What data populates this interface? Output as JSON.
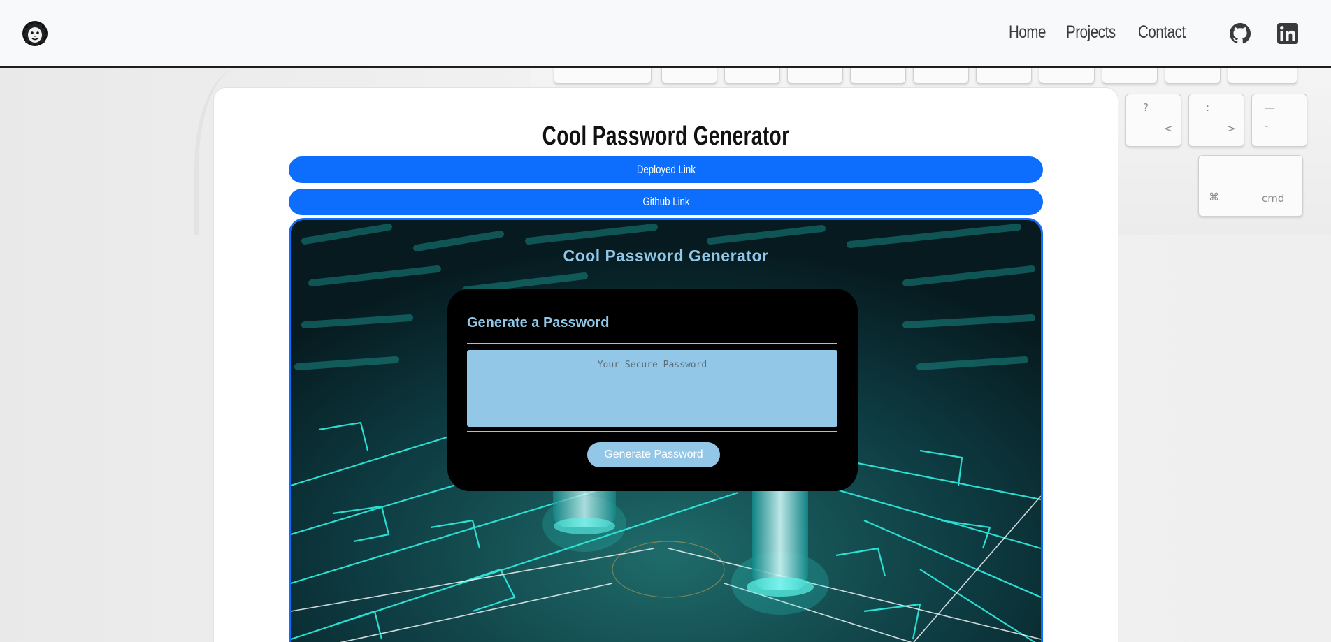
{
  "nav": {
    "links": [
      "Home",
      "Projects",
      "Contact"
    ],
    "social_icons": [
      "github-icon",
      "linkedin-icon"
    ],
    "logo_icon": "lion-head-icon"
  },
  "card": {
    "title": "Cool Password Generator",
    "deployed_link_label": "Deployed Link",
    "github_link_label": "Github Link"
  },
  "preview": {
    "app_title": "Cool Password Generator",
    "heading": "Generate a Password",
    "password_placeholder": "Your Secure Password",
    "generate_button_label": "Generate Password"
  },
  "keyboard": {
    "keys": [
      "?",
      "/",
      ":",
      ";",
      ">",
      "<",
      "—",
      "-",
      "⌘",
      "cmd"
    ]
  },
  "colors": {
    "nav_bg": "#f8f9fa",
    "primary": "#0d6efd",
    "accent_light_blue": "#92c7e8",
    "card_bg": "#ffffff"
  }
}
